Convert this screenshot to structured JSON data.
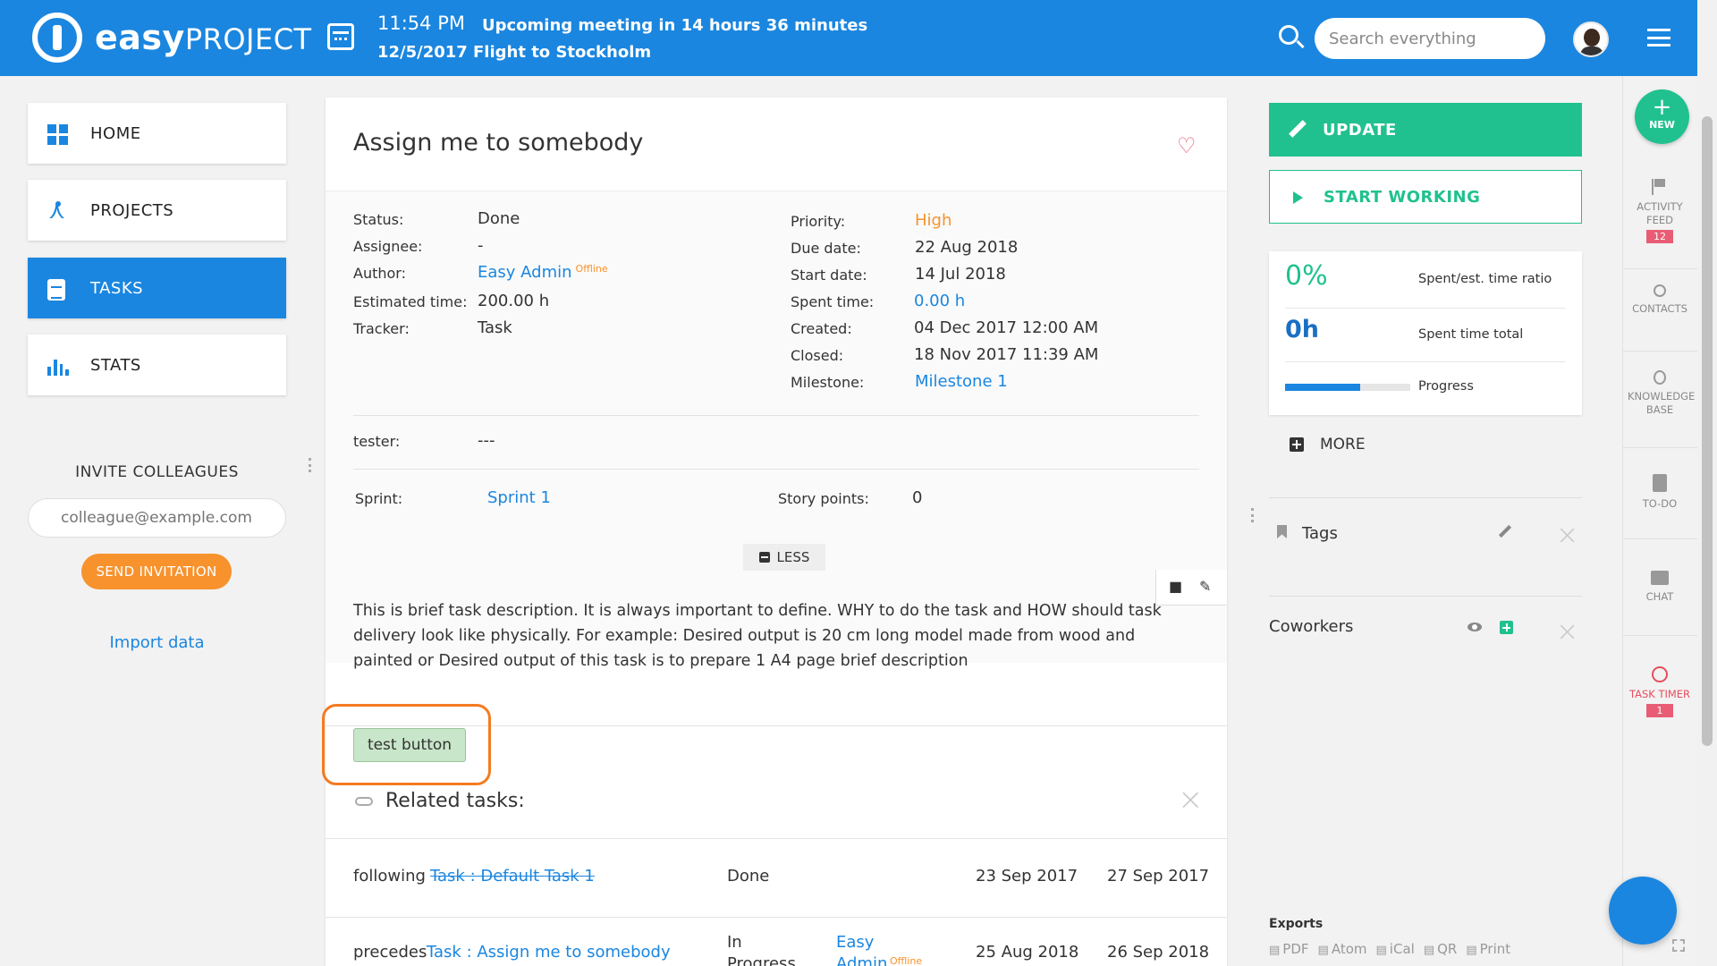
{
  "topbar": {
    "logo_bold": "easy",
    "logo_light": "PROJECT",
    "time": "11:54 PM",
    "date": "12/5/2017",
    "meeting": "Upcoming meeting in 14 hours 36 minutes",
    "flight": "Flight to Stockholm",
    "search_placeholder": "Search everything"
  },
  "nav": {
    "items": [
      {
        "label": "HOME",
        "icon": "dashboard-icon"
      },
      {
        "label": "PROJECTS",
        "icon": "projects-icon"
      },
      {
        "label": "TASKS",
        "icon": "tasks-icon",
        "active": true
      },
      {
        "label": "STATS",
        "icon": "stats-icon"
      }
    ],
    "invite_title": "INVITE COLLEAGUES",
    "invite_placeholder": "colleague@example.com",
    "invite_button": "SEND INVITATION",
    "import_link": "Import data"
  },
  "task": {
    "title": "Assign me to somebody",
    "left_attrs": [
      {
        "label": "Status:",
        "value": "Done"
      },
      {
        "label": "Assignee:",
        "value": "-"
      },
      {
        "label": "Author:",
        "value": "Easy Admin",
        "badge": "Offline"
      },
      {
        "label": "Estimated time:",
        "value": "200.00 h"
      },
      {
        "label": "Tracker:",
        "value": "Task"
      }
    ],
    "right_attrs": [
      {
        "label": "Priority:",
        "value": "High"
      },
      {
        "label": "Due date:",
        "value": "22 Aug 2018"
      },
      {
        "label": "Start date:",
        "value": "14 Jul 2018"
      },
      {
        "label": "Spent time:",
        "value": "0.00 h"
      },
      {
        "label": "Created:",
        "value": "04 Dec 2017 12:00 AM"
      },
      {
        "label": "Closed:",
        "value": "18 Nov 2017 11:39 AM"
      },
      {
        "label": "Milestone:",
        "value": "Milestone 1"
      }
    ],
    "tester_label": "tester:",
    "tester_value": "---",
    "sprint_label": "Sprint:",
    "sprint_value": "Sprint 1",
    "story_label": "Story points:",
    "story_value": "0",
    "less_label": "LESS",
    "description": "This is brief task description. It is always important to define. WHY to do the task and HOW should task delivery look like physically. For example: Desired output is 20 cm long model made from wood and painted or Desired output of this task is to prepare 1 A4 page brief description",
    "test_button": "test button",
    "related_title": "Related tasks:",
    "related": [
      {
        "relation": "following",
        "task": "Task : Default Task 1",
        "status": "Done",
        "assignee": "",
        "assignee_badge": "",
        "start": "23 Sep 2017",
        "end": "27 Sep 2017"
      },
      {
        "relation": "precedes",
        "task": "Task : Assign me to somebody",
        "status": "In Progress",
        "assignee": "Easy Admin",
        "assignee_badge": "Offline",
        "start": "25 Aug 2018",
        "end": "26 Sep 2018"
      }
    ]
  },
  "side": {
    "update_label": "UPDATE",
    "start_label": "START WORKING",
    "ratio_value": "0%",
    "ratio_label": "Spent/est. time ratio",
    "total_value": "0h",
    "total_label": "Spent time total",
    "progress_label": "Progress",
    "progress_percent": 60,
    "more_label": "MORE",
    "tags_label": "Tags",
    "coworkers_label": "Coworkers",
    "exports_title": "Exports",
    "exports": [
      "PDF",
      "Atom",
      "iCal",
      "QR",
      "Print"
    ]
  },
  "rail": {
    "new_label": "NEW",
    "activity_label": "ACTIVITY FEED",
    "activity_badge": "12",
    "contacts_label": "CONTACTS",
    "kb_label": "KNOWLEDGE BASE",
    "todo_label": "TO-DO",
    "chat_label": "CHAT",
    "timer_label": "TASK TIMER",
    "timer_badge": "1"
  },
  "colors": {
    "primary": "#1a86e0",
    "success": "#20c18e",
    "accent": "#f7922d",
    "danger": "#e85d75"
  }
}
